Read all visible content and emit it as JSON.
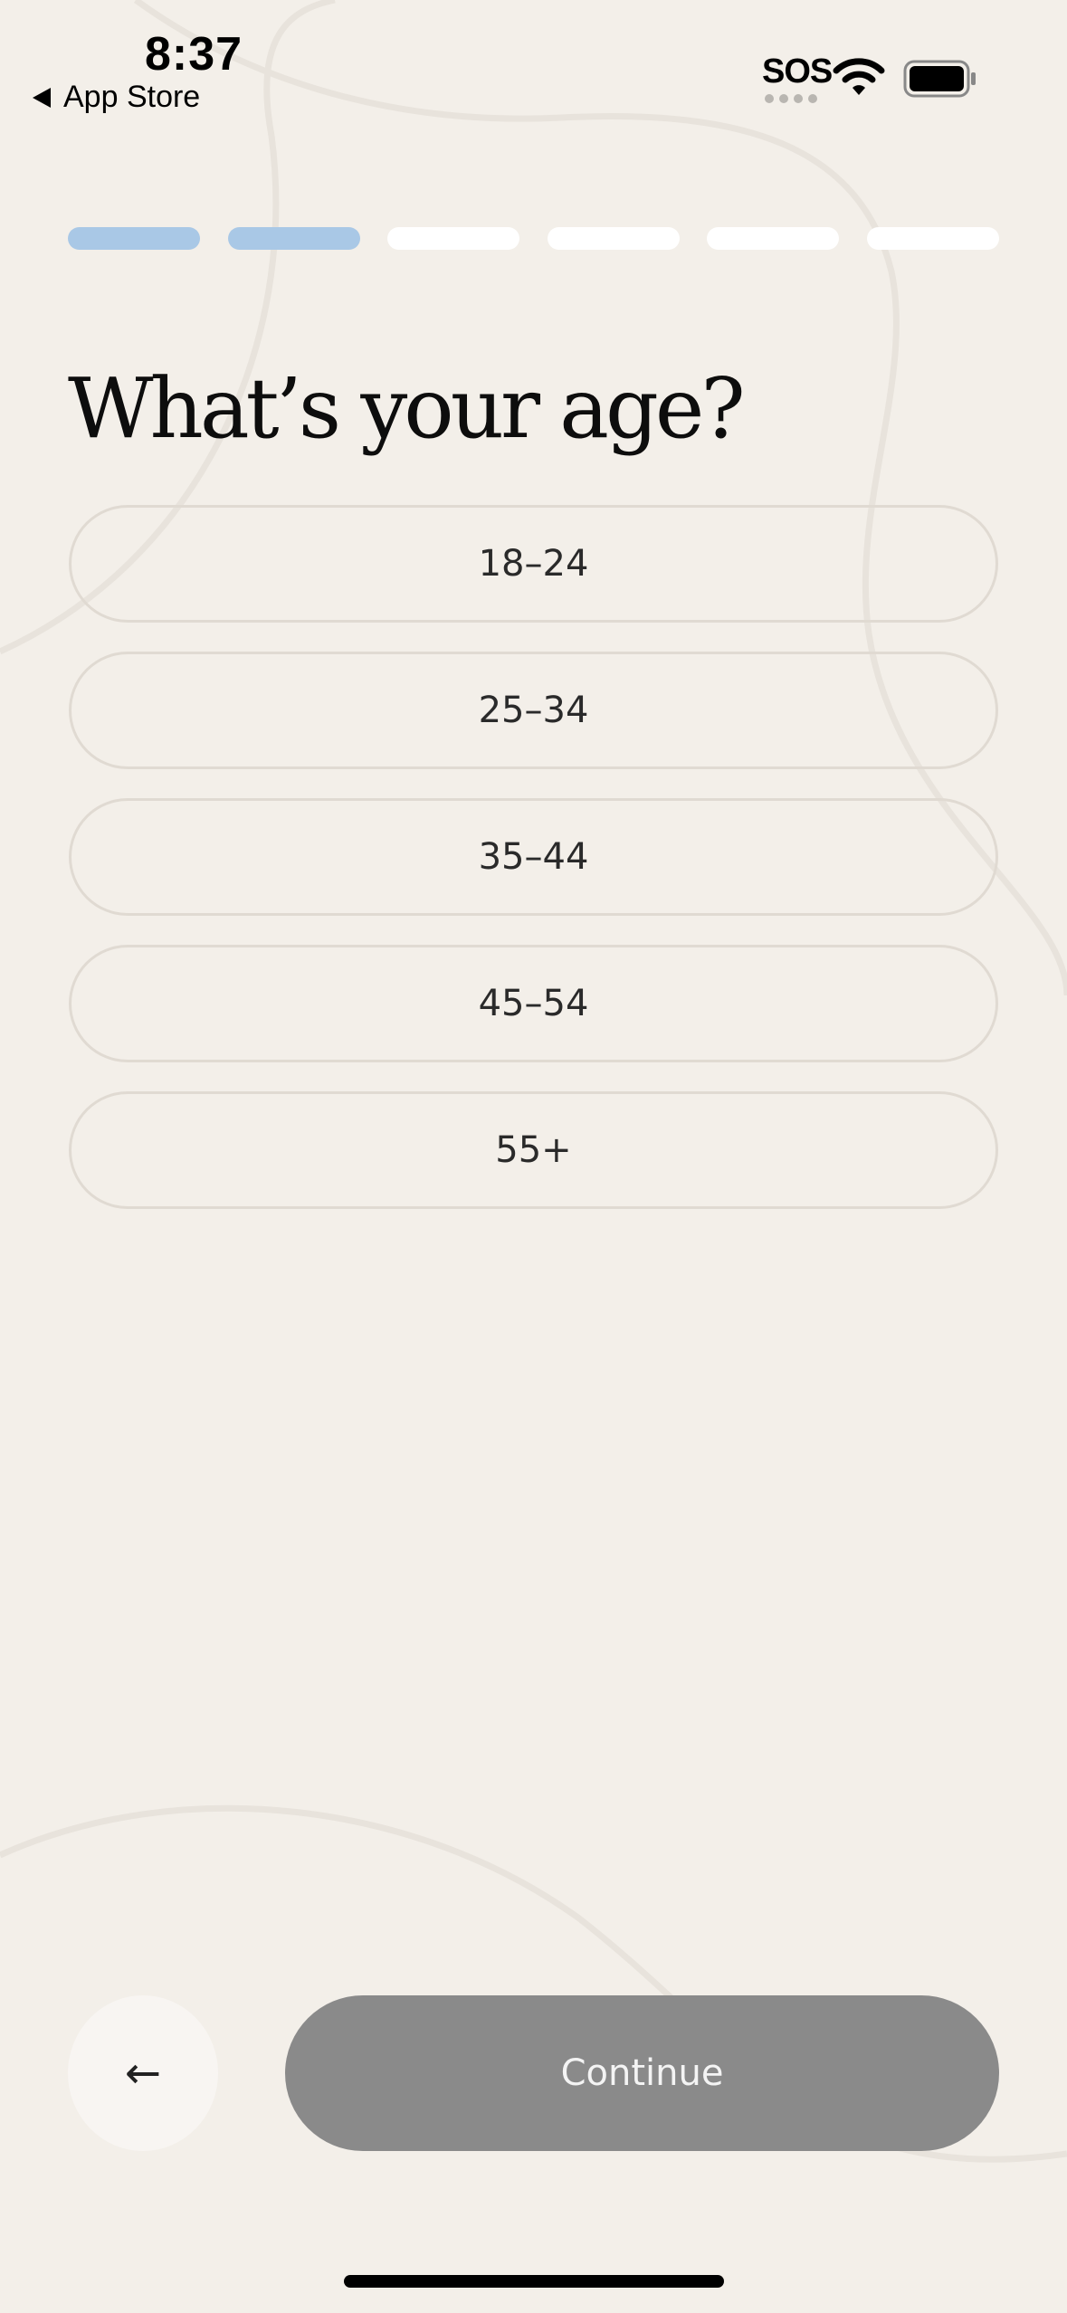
{
  "status_bar": {
    "time": "8:37",
    "back_label": "App Store",
    "carrier": "SOS"
  },
  "progress": {
    "total_steps": 6,
    "completed_steps": 2,
    "completed_color": "#a9c8e6",
    "pending_color": "#ffffff"
  },
  "question": {
    "title": "What’s your age?"
  },
  "options": [
    {
      "label": "18–24"
    },
    {
      "label": "25–34"
    },
    {
      "label": "35–44"
    },
    {
      "label": "45–54"
    },
    {
      "label": "55+"
    }
  ],
  "footer": {
    "back_icon": "←",
    "continue_label": "Continue"
  },
  "colors": {
    "background": "#f3efe9",
    "continue_disabled": "#8a8a8a"
  }
}
